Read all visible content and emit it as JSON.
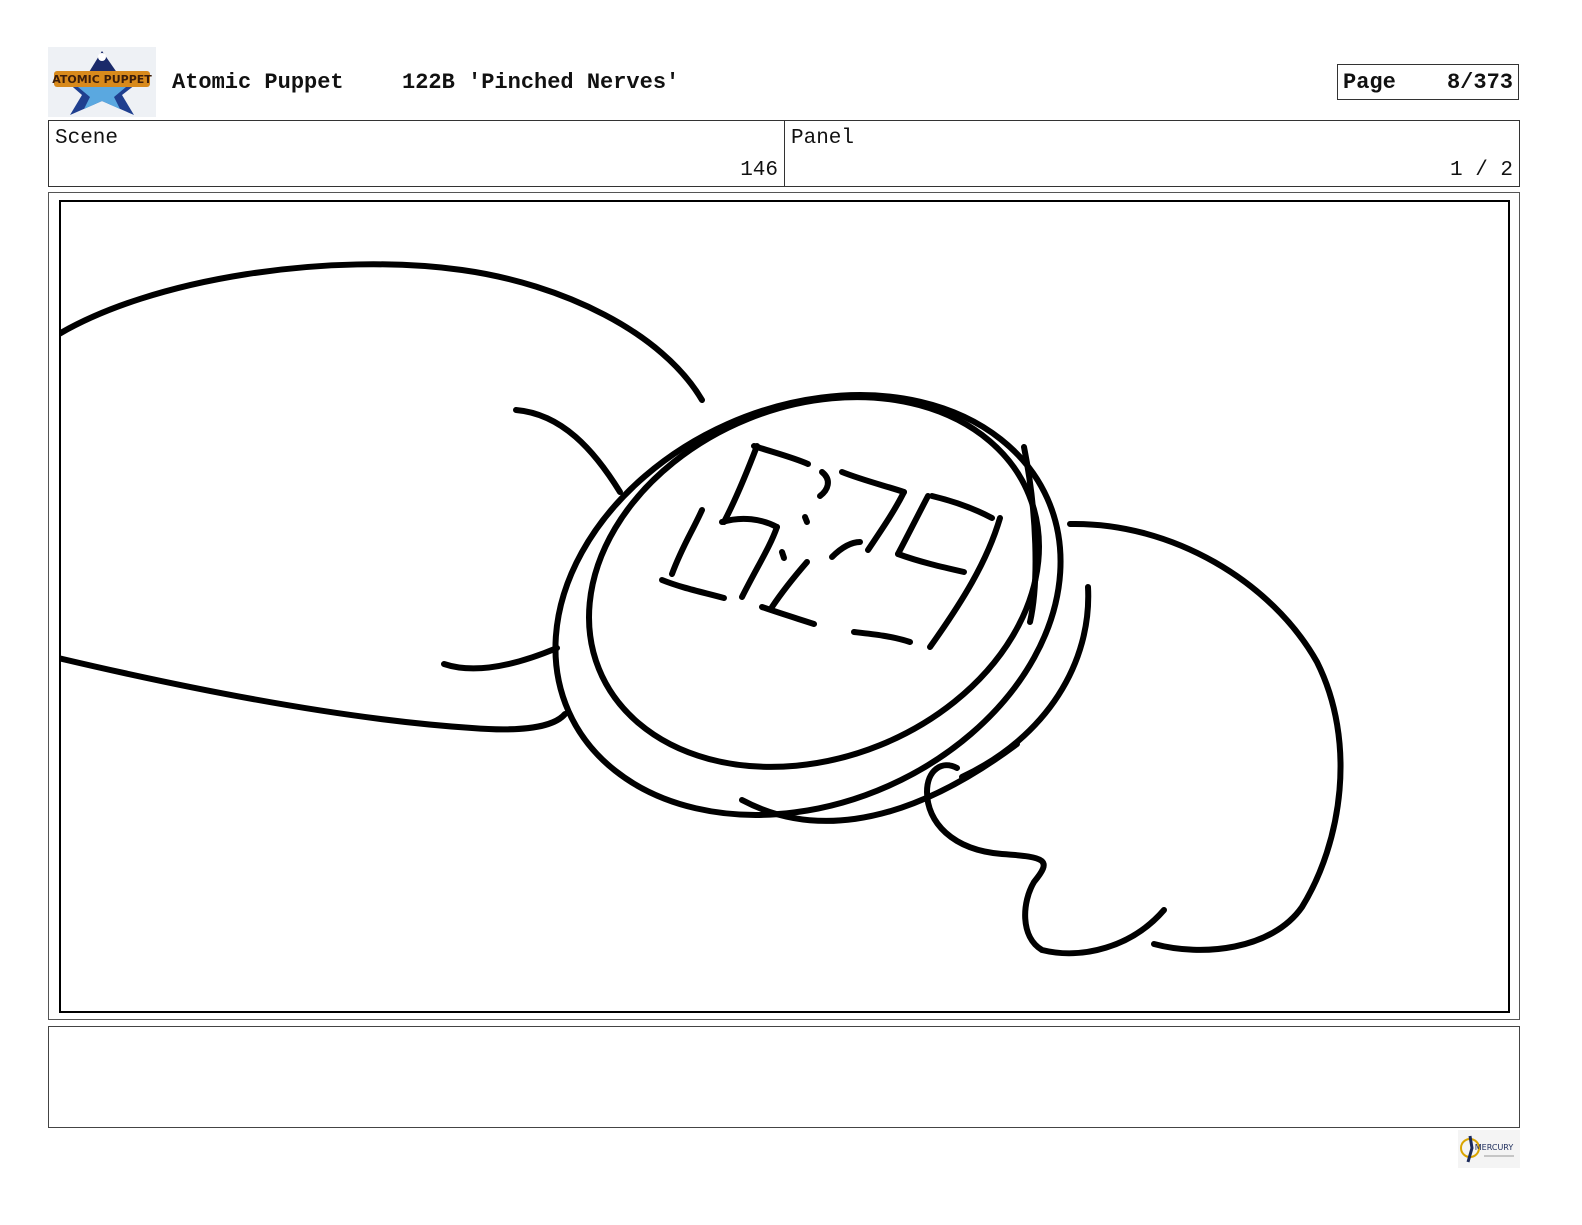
{
  "header": {
    "show_title": "Atomic Puppet",
    "episode_title": "122B 'Pinched Nerves'",
    "page_label": "Page",
    "page_value": "8/373"
  },
  "info": {
    "scene_label": "Scene",
    "scene_value": "146",
    "panel_label": "Panel",
    "panel_value": "1 / 2"
  },
  "panel": {
    "watch_display": "6:29"
  },
  "notes": {
    "text": ""
  },
  "logos": {
    "show_logo": "ATOMIC PUPPET",
    "studio_logo": "MERCURY"
  }
}
